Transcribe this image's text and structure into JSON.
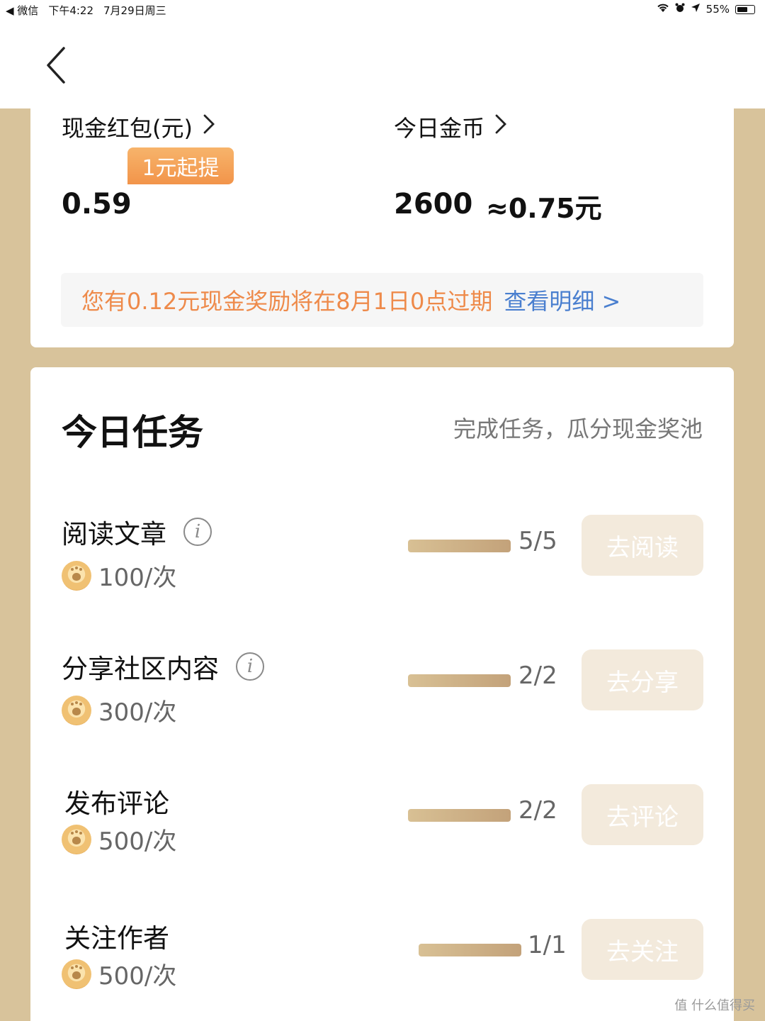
{
  "status_bar": {
    "back_app": "◀ 微信",
    "time": "下午4:22",
    "date": "7月29日周三",
    "battery": "55%"
  },
  "wallet": {
    "cash_label": "现金红包(元)",
    "cash_badge": "1元起提",
    "cash_value": "0.59",
    "coins_label": "今日金币",
    "coins_value": "2600",
    "coins_approx": "≈0.75元"
  },
  "notice": {
    "text": "您有0.12元现金奖励将在8月1日0点过期",
    "link": "查看明细 >"
  },
  "tasks": {
    "title": "今日任务",
    "subtitle": "完成任务，瓜分现金奖池",
    "items": [
      {
        "name": "阅读文章",
        "reward": "100/次",
        "progress_text": "5/5",
        "progress": 1.0,
        "button": "去阅读",
        "has_info": true
      },
      {
        "name": "分享社区内容",
        "reward": "300/次",
        "progress_text": "2/2",
        "progress": 1.0,
        "button": "去分享",
        "has_info": true
      },
      {
        "name": "发布评论",
        "reward": "500/次",
        "progress_text": "2/2",
        "progress": 1.0,
        "button": "去评论",
        "has_info": false
      },
      {
        "name": "关注作者",
        "reward": "500/次",
        "progress_text": "1/1",
        "progress": 1.0,
        "button": "去关注",
        "has_info": false
      }
    ]
  },
  "watermark": "值 什么值得买"
}
